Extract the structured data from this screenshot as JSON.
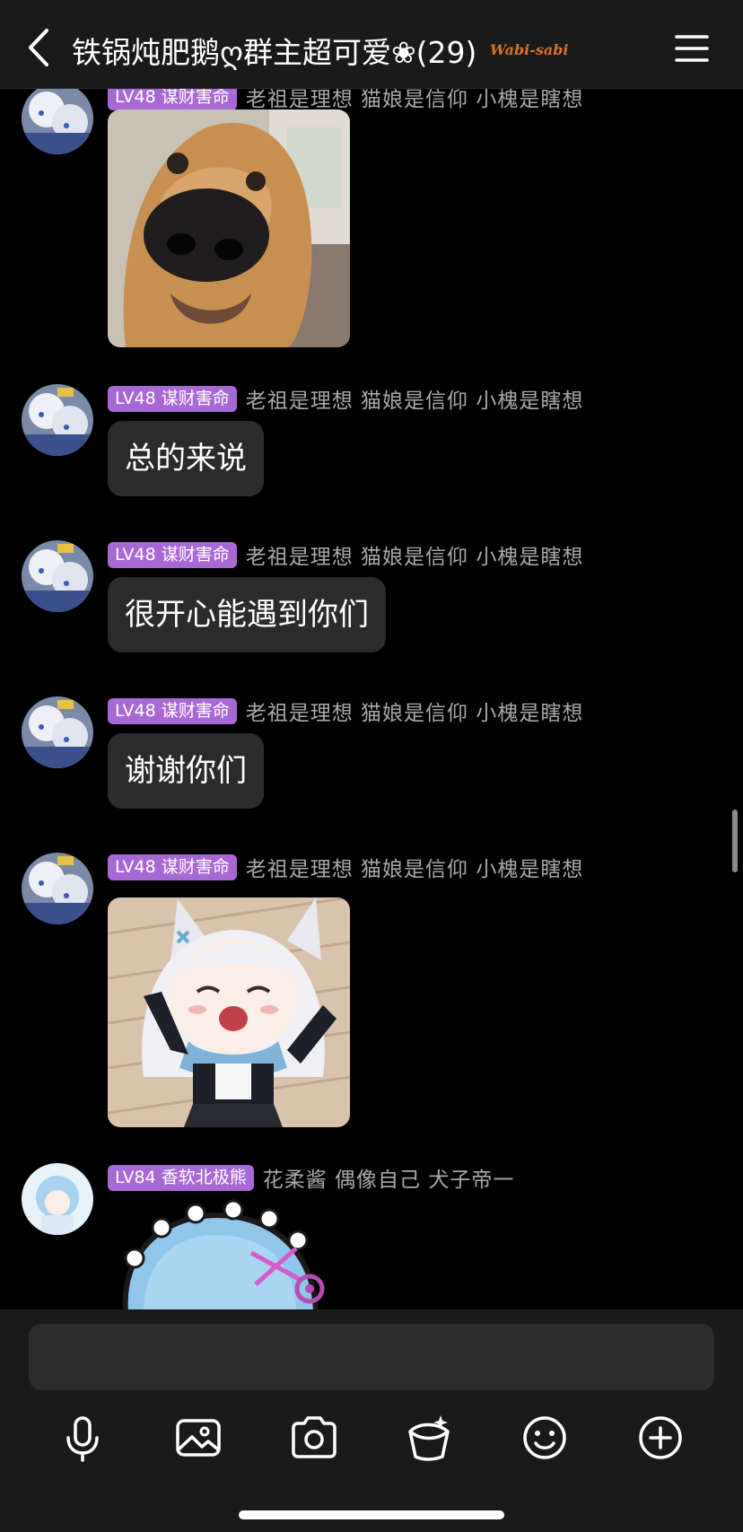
{
  "header": {
    "title": "铁锅炖肥鹅ღ群主超可爱❀(29)",
    "badge": "Wabi-sabi",
    "back_icon": "chevron-left-icon",
    "menu_icon": "hamburger-menu-icon"
  },
  "messages": [
    {
      "type": "image",
      "level": "LV48 谋财害命",
      "nick": "老祖是理想  猫娘是信仰   小槐是瞎想",
      "image": "shiba-dog-closeup-photo"
    },
    {
      "type": "text",
      "level": "LV48 谋财害命",
      "nick": "老祖是理想  猫娘是信仰   小槐是瞎想",
      "text": "总的来说"
    },
    {
      "type": "text",
      "level": "LV48 谋财害命",
      "nick": "老祖是理想  猫娘是信仰   小槐是瞎想",
      "text": "很开心能遇到你们"
    },
    {
      "type": "text",
      "level": "LV48 谋财害命",
      "nick": "老祖是理想  猫娘是信仰   小槐是瞎想",
      "text": "谢谢你们"
    },
    {
      "type": "image",
      "level": "LV48 谋财害命",
      "nick": "老祖是理想  猫娘是信仰   小槐是瞎想",
      "image": "anime-catgirl-sticker"
    },
    {
      "type": "image",
      "level": "LV84 香软北极熊",
      "nick": "花柔酱 偶像自己 犬子帝一",
      "image": "anime-blue-hair-sticker"
    }
  ],
  "input": {
    "placeholder": ""
  },
  "toolbar": {
    "icons": [
      "microphone-icon",
      "image-icon",
      "camera-icon",
      "red-packet-icon",
      "emoji-icon",
      "plus-icon"
    ]
  },
  "colors": {
    "header_bg": "#1a1a1a",
    "bubble_bg": "#2b2b2b",
    "level_badge": "#a868d6",
    "nick_text": "#a8a8a8"
  }
}
